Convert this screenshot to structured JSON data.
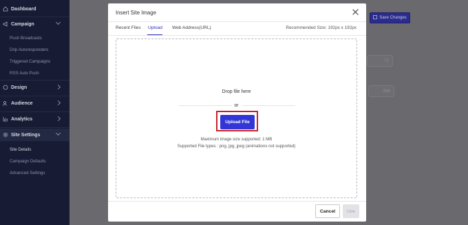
{
  "sidebar": {
    "items": [
      {
        "label": "Dashboard",
        "icon": "home-icon"
      },
      {
        "label": "Campaign",
        "icon": "megaphone-icon"
      },
      {
        "label": "Push Broadcasts"
      },
      {
        "label": "Drip Autoresponders"
      },
      {
        "label": "Triggered Campaigns"
      },
      {
        "label": "RSS Auto Push"
      },
      {
        "label": "Design",
        "icon": "palette-icon"
      },
      {
        "label": "Audience",
        "icon": "users-icon"
      },
      {
        "label": "Analytics",
        "icon": "chart-icon"
      },
      {
        "label": "Site Settings",
        "icon": "gear-icon"
      },
      {
        "label": "Site Details"
      },
      {
        "label": "Campaign Defaults"
      },
      {
        "label": "Advanced Settings"
      }
    ]
  },
  "background": {
    "save_label": "Save Changes",
    "field1_value": "72",
    "field2_value": "388"
  },
  "modal": {
    "title": "Insert Site Image",
    "tabs": [
      "Recent Files",
      "Upload",
      "Web Address(URL)"
    ],
    "active_tab": "Upload",
    "recommended_size": "Recommended Size: 192px x 192px",
    "drop_text": "Drop file here",
    "or_text": "or",
    "upload_label": "Upload File",
    "max_size": "Maximum image size supported: 1 MB",
    "file_types": "Supported File types : png, jpg, jpeg (animations not supported)",
    "cancel_label": "Cancel",
    "use_label": "Use"
  },
  "colors": {
    "sidebar_bg": "#171b33",
    "accent": "#3336d6",
    "highlight": "#c8202a"
  }
}
